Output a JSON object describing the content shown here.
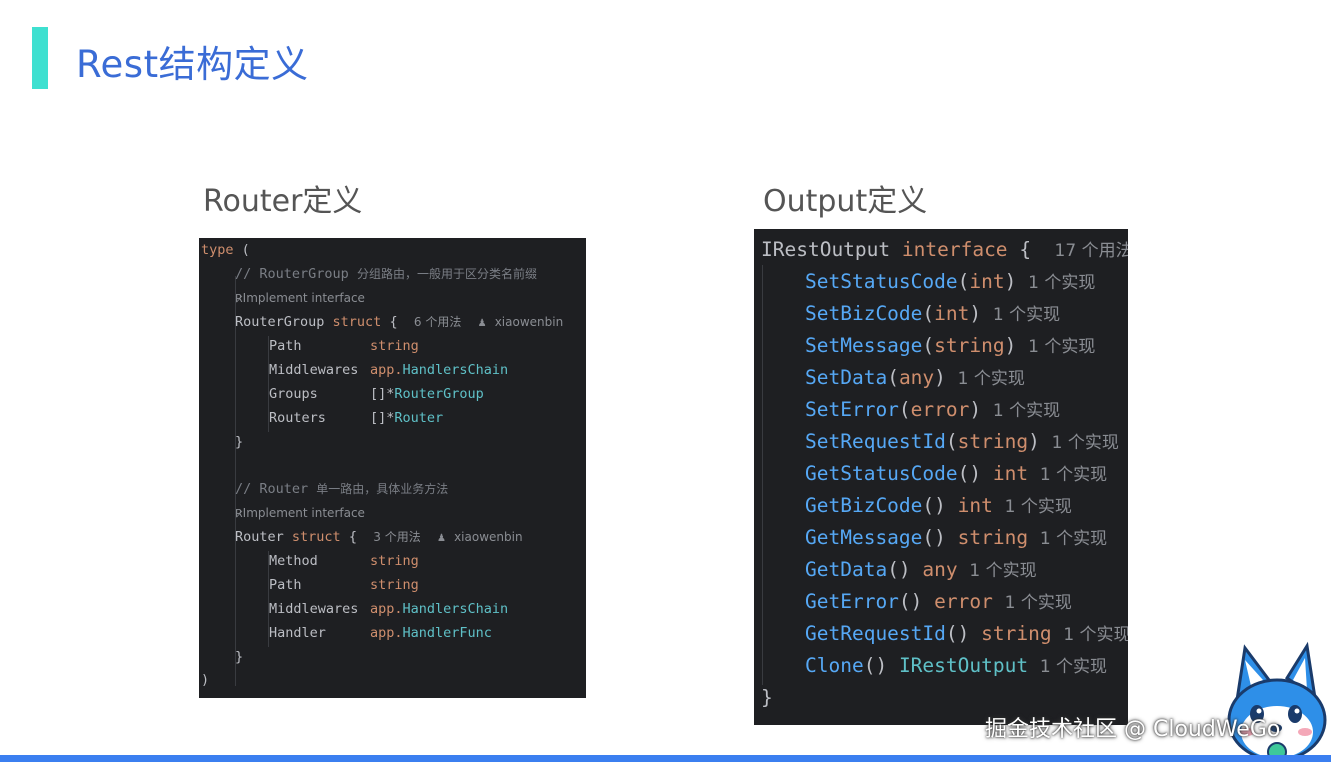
{
  "slide": {
    "title": "Rest结构定义"
  },
  "sections": {
    "router_title": "Router定义",
    "output_title": "Output定义"
  },
  "router_code": {
    "type_kw": "type",
    "open_paren": "(",
    "c1_prefix": "// RouterGroup",
    "c1_text": "分组路由，一般用于区分类名前缀",
    "impl_label": "Implement interface",
    "rg_name": "RouterGroup",
    "struct_kw": "struct",
    "brace_open": "{",
    "rg_usages": "6 个用法",
    "author": "xiaowenbin",
    "f_path": "Path",
    "t_string": "string",
    "f_middlewares": "Middlewares",
    "t_app": "app.",
    "t_handlerschain": "HandlersChain",
    "f_groups": "Groups",
    "t_slice_ptr": "[]*",
    "t_routergroup": "RouterGroup",
    "f_routers": "Routers",
    "t_router": "Router",
    "brace_close": "}",
    "c2_prefix": "// Router",
    "c2_text": "单一路由，具体业务方法",
    "r_name": "Router",
    "r_usages": "3 个用法",
    "f_method": "Method",
    "f_handler": "Handler",
    "t_handlerfunc": "HandlerFunc",
    "close_paren": ")"
  },
  "output_code": {
    "name": "IRestOutput",
    "interface_kw": "interface",
    "brace_open": "{",
    "usages": "17 个用法",
    "impl": "1 个实现",
    "m1": "SetStatusCode",
    "m2": "SetBizCode",
    "m3": "SetMessage",
    "m4": "SetData",
    "m5": "SetError",
    "m6": "SetRequestId",
    "m7": "GetStatusCode",
    "m8": "GetBizCode",
    "m9": "GetMessage",
    "m10": "GetData",
    "m11": "GetError",
    "m12": "GetRequestId",
    "m13": "Clone",
    "t_int": "int",
    "t_string": "string",
    "t_any": "any",
    "t_error": "error",
    "t_irestoutput": "IRestOutput",
    "lp": "(",
    "rp": ")",
    "parens": "()",
    "brace_close": "}"
  },
  "watermark": "掘金技术社区 @ CloudWeGo",
  "colors": {
    "accent": "#3ee0d0",
    "title_blue": "#3a6cd6",
    "code_bg": "#1e1f22",
    "bottom_bar": "#3b7ff0"
  }
}
